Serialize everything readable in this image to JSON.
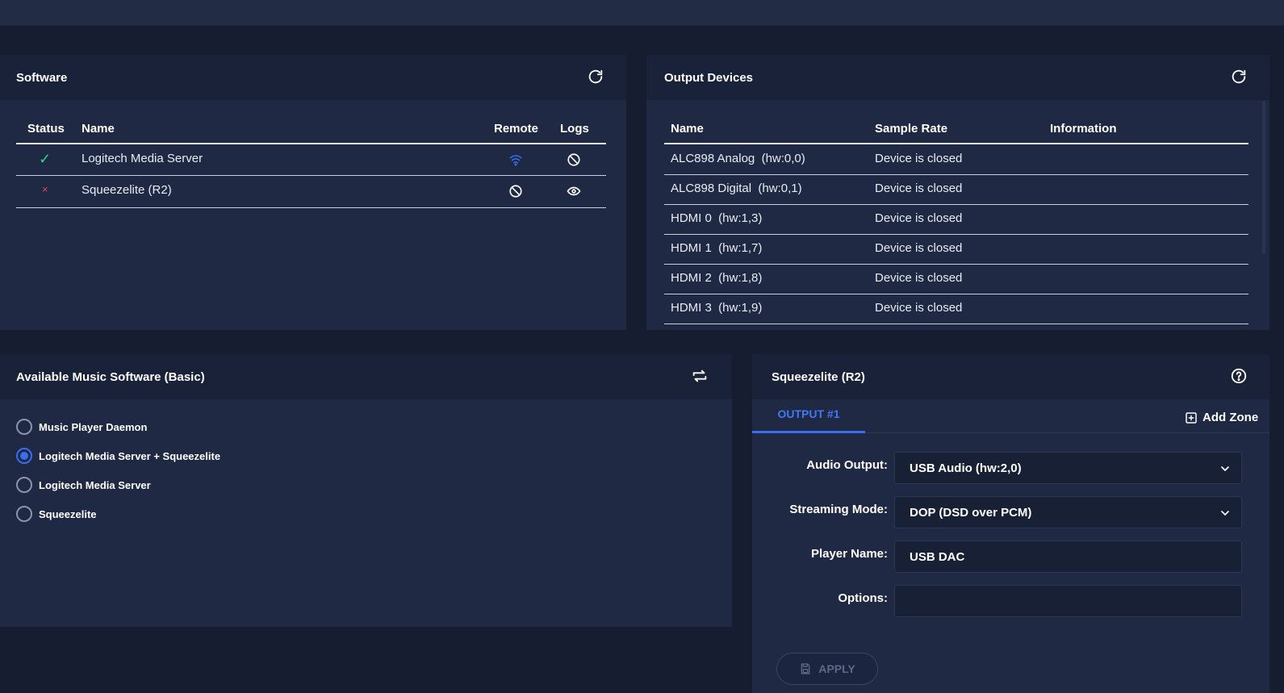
{
  "software_panel": {
    "title": "Software",
    "columns": [
      "Status",
      "Name",
      "Remote",
      "Logs"
    ],
    "rows": [
      {
        "status": "✓",
        "name": "Logitech Media Server"
      },
      {
        "status": "×",
        "name": "Squeezelite (R2)"
      }
    ]
  },
  "output_panel": {
    "title": "Output Devices",
    "columns": [
      "Name",
      "Sample Rate",
      "Information"
    ],
    "rows": [
      {
        "name": "ALC898 Analog  (hw:0,0)",
        "rate": "Device is closed"
      },
      {
        "name": "ALC898 Digital  (hw:0,1)",
        "rate": "Device is closed"
      },
      {
        "name": "HDMI 0  (hw:1,3)",
        "rate": "Device is closed"
      },
      {
        "name": "HDMI 1  (hw:1,7)",
        "rate": "Device is closed"
      },
      {
        "name": "HDMI 2  (hw:1,8)",
        "rate": "Device is closed"
      },
      {
        "name": "HDMI 3  (hw:1,9)",
        "rate": "Device is closed"
      }
    ]
  },
  "music_panel": {
    "title": "Available Music Software  (Basic)",
    "options": [
      {
        "label": "Music Player Daemon",
        "selected": false
      },
      {
        "label": "Logitech Media Server + Squeezelite",
        "selected": true
      },
      {
        "label": "Logitech Media Server",
        "selected": false
      },
      {
        "label": "Squeezelite",
        "selected": false
      }
    ]
  },
  "squeezelite_panel": {
    "title": "Squeezelite (R2)",
    "tab": "OUTPUT #1",
    "add_zone": "Add Zone",
    "audio_output_label": "Audio Output:",
    "audio_output_value": "USB Audio (hw:2,0)",
    "streaming_mode_label": "Streaming Mode:",
    "streaming_mode_value": "DOP (DSD over PCM)",
    "player_name_label": "Player Name:",
    "player_name_value": "USB DAC",
    "options_label": "Options:",
    "options_value": "",
    "apply_label": "APPLY"
  },
  "colors": {
    "accent": "#3b6df2",
    "ok": "#2fd18a",
    "error": "#e0485a"
  },
  "icons": [
    "refresh-icon",
    "wifi-icon",
    "ban-icon",
    "eye-icon",
    "swap-icon",
    "help-icon",
    "add-box-icon",
    "chevron-down-icon",
    "save-icon",
    "check-icon",
    "close-icon"
  ]
}
